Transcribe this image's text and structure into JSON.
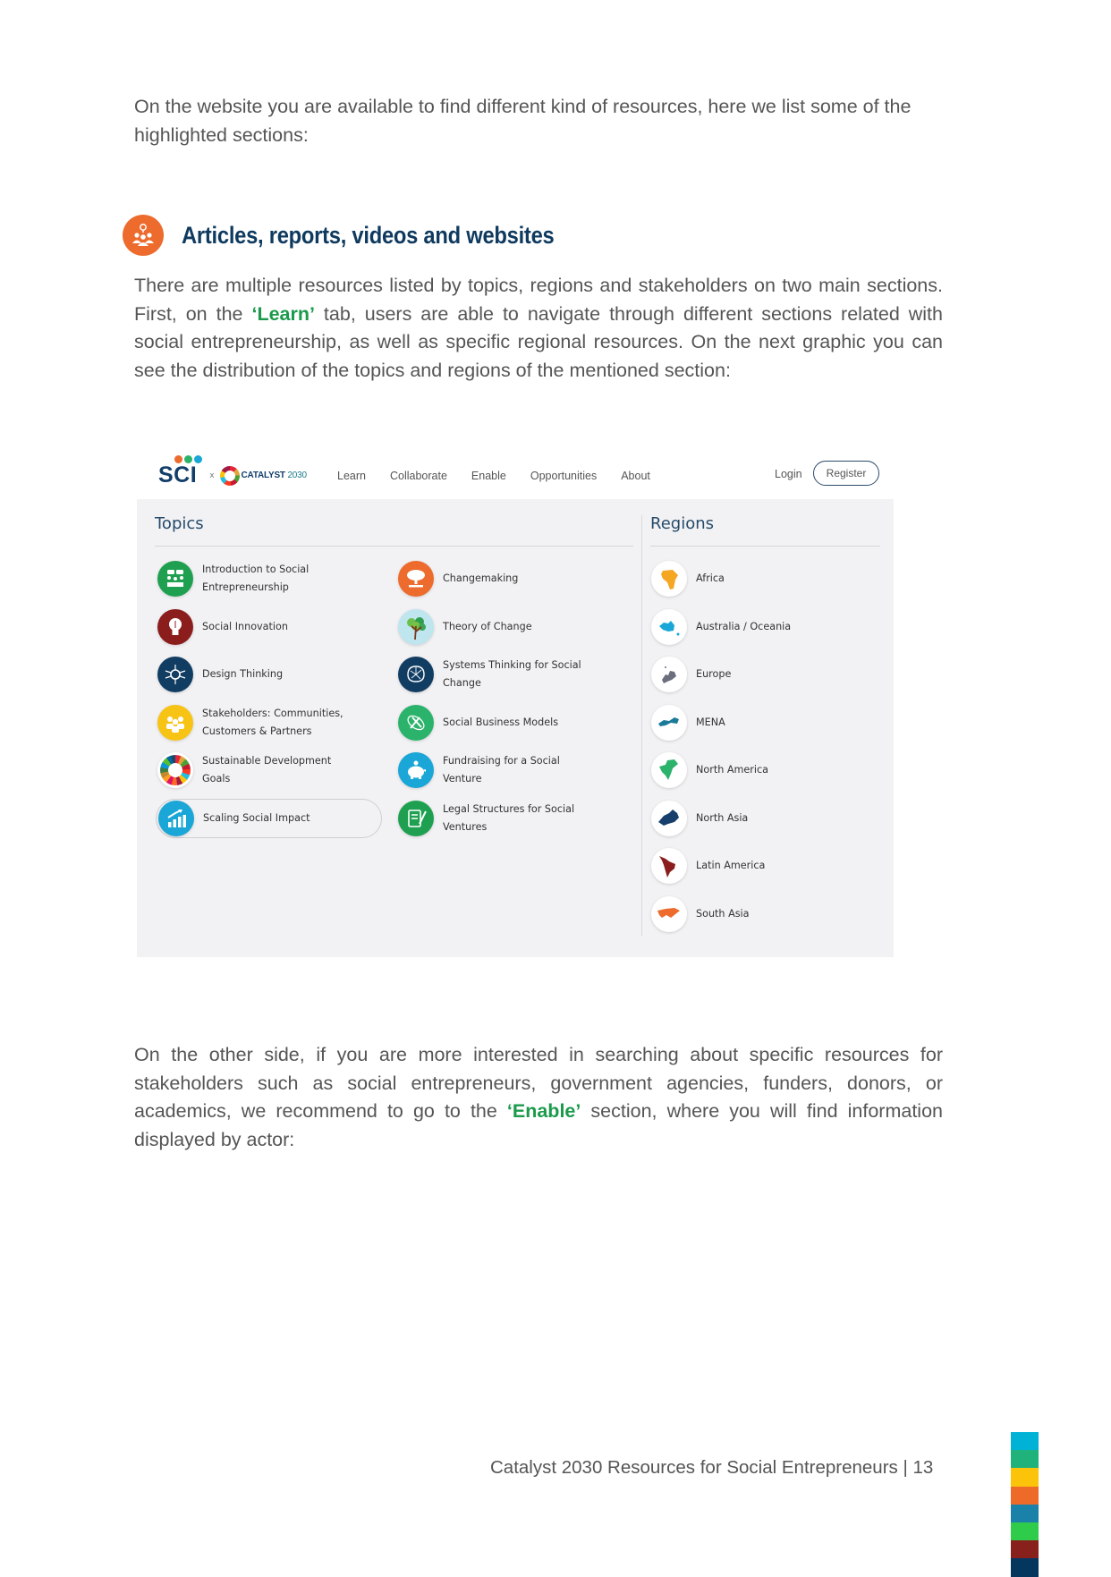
{
  "intro": {
    "text": "On the website you are available to find different kind of resources, here we list some of the highlighted sections:"
  },
  "section": {
    "icon": "people-lightbulb-icon",
    "title": "Articles, reports, videos and websites",
    "paragraph": {
      "before": "There are multiple resources listed by topics, regions and stakeholders on two main sections. First, on the ",
      "highlight": "‘Learn’",
      "after": " tab, users are able to navigate through different sections related with social entrepreneurship, as well as specific regional resources. On the next graphic you can see the distribution of the topics and regions of the mentioned section:"
    }
  },
  "screenshot": {
    "logo": {
      "primary": "SCI",
      "separator": "x",
      "partner_bold": "CATALYST",
      "partner_year": "2030"
    },
    "nav": [
      "Learn",
      "Collaborate",
      "Enable",
      "Opportunities",
      "About"
    ],
    "login": "Login",
    "register": "Register",
    "topics": {
      "title": "Topics",
      "left": [
        {
          "label": "Introduction to Social Entrepreneurship",
          "icon": "team-meeting-icon",
          "color": "#1fa050"
        },
        {
          "label": "Social Innovation",
          "icon": "lightbulb-icon",
          "color": "#8b1d1d"
        },
        {
          "label": "Design Thinking",
          "icon": "brain-network-icon",
          "color": "#123d63"
        },
        {
          "label": "Stakeholders: Communities, Customers & Partners",
          "icon": "group-icon",
          "color": "#f7c315"
        },
        {
          "label": "Sustainable Development Goals",
          "icon": "sdg-wheel-icon",
          "color": "#ffffff"
        },
        {
          "label": "Scaling Social Impact",
          "icon": "growth-chart-icon",
          "color": "#1aa6d6",
          "active": true
        }
      ],
      "right": [
        {
          "label": "Changemaking",
          "icon": "ashoka-tree-icon",
          "color": "#ec6b2d"
        },
        {
          "label": "Theory of Change",
          "icon": "tree-icon",
          "color": "#bfe5ef"
        },
        {
          "label": "Systems Thinking for Social Change",
          "icon": "network-brain-icon",
          "color": "#123d63"
        },
        {
          "label": "Social Business Models",
          "icon": "business-model-icon",
          "color": "#2bb36b"
        },
        {
          "label": "Fundraising for a Social Venture",
          "icon": "piggy-bank-icon",
          "color": "#1aa6d6"
        },
        {
          "label": "Legal Structures for Social Ventures",
          "icon": "document-pen-icon",
          "color": "#1fa050"
        }
      ]
    },
    "regions": {
      "title": "Regions",
      "items": [
        {
          "label": "Africa",
          "icon": "africa-map-icon",
          "color": "#f5a623"
        },
        {
          "label": "Australia / Oceania",
          "icon": "oceania-map-icon",
          "color": "#1aa6d6"
        },
        {
          "label": "Europe",
          "icon": "europe-map-icon",
          "color": "#6b6f7d"
        },
        {
          "label": "MENA",
          "icon": "mena-map-icon",
          "color": "#1b7a9a"
        },
        {
          "label": "North America",
          "icon": "north-america-map-icon",
          "color": "#2bb36b"
        },
        {
          "label": "North Asia",
          "icon": "north-asia-map-icon",
          "color": "#173f6b"
        },
        {
          "label": "Latin America",
          "icon": "latin-america-map-icon",
          "color": "#8b1d1d"
        },
        {
          "label": "South Asia",
          "icon": "south-asia-map-icon",
          "color": "#ec6b2d"
        }
      ]
    }
  },
  "enable_paragraph": {
    "before": "On the other side, if you are more interested in searching about specific resources for stakeholders such as social entrepreneurs, government agencies, funders, donors, or academics, we recommend to go to the ",
    "highlight": "‘Enable’",
    "after": " section, where you will find information displayed by actor:"
  },
  "footer": {
    "text": "Catalyst 2030 Resources for Social Entrepreneurs | 13",
    "stripe_colors": [
      "#00b2d6",
      "#1fb27a",
      "#fcc30b",
      "#ee6a29",
      "#1a82a8",
      "#2fcc4c",
      "#88211c",
      "#04365e"
    ]
  },
  "colors": {
    "heading": "#0f3a5f",
    "highlight": "#1a9a4a",
    "body_text": "#555555",
    "accent_orange": "#ec6b2d"
  }
}
